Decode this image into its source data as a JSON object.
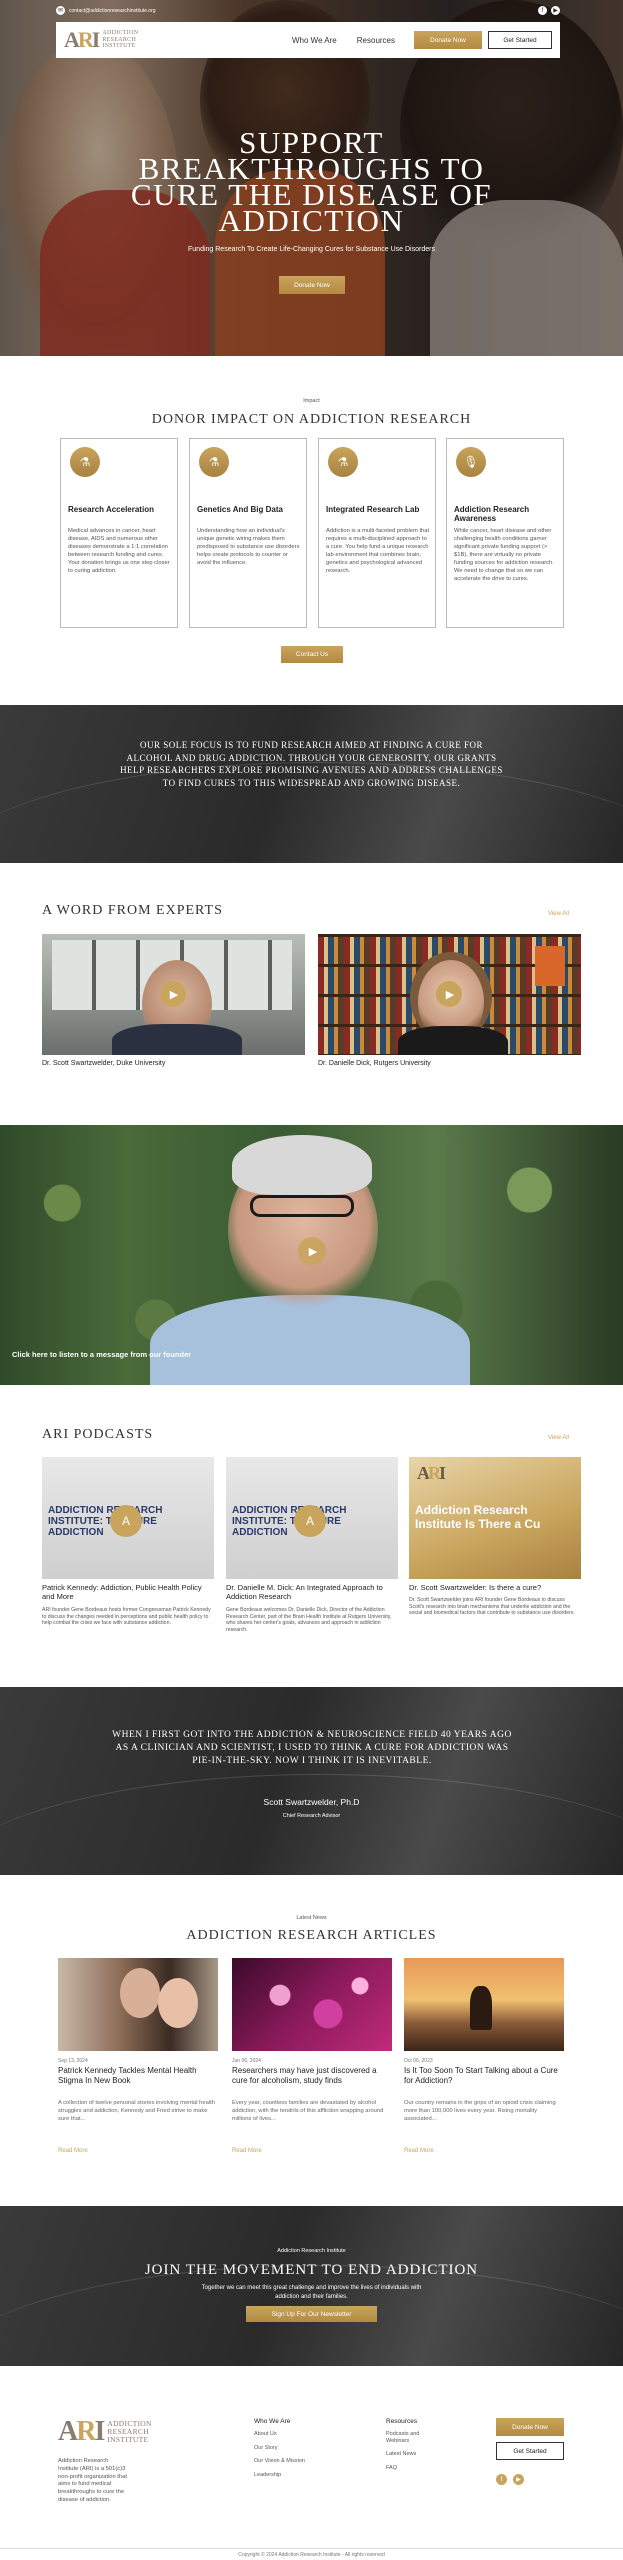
{
  "topbar": {
    "email": "contact@addictionresearchinstitute.org"
  },
  "brand": {
    "mark": "ARI",
    "name_line1": "Addiction",
    "name_line2": "Research",
    "name_line3": "Institute"
  },
  "nav": {
    "who_we_are": "Who We Are",
    "resources": "Resources",
    "donate": "Donate Now",
    "get_started": "Get Started"
  },
  "hero": {
    "title": "Support Breakthroughs to Cure the Disease of Addiction",
    "subtitle": "Funding Research To Create Life-Changing Cures for Substance Use Disorders",
    "cta": "Donate Now"
  },
  "impact": {
    "kicker": "Impact",
    "title": "Donor Impact on Addiction Research",
    "cards": [
      {
        "icon": "flask-icon",
        "title": "Research Acceleration",
        "desc": "Medical advances in cancer, heart disease, AIDS and numerous other diseases demonstrate a 1:1 correlation between research funding and cures. Your donation brings us one step closer to curing addiction."
      },
      {
        "icon": "dna-icon",
        "title": "Genetics And Big Data",
        "desc": "Understanding how an individual's unique genetic wiring makes them predisposed to substance use disorders helps create protocols to counter or avoid the influence."
      },
      {
        "icon": "lab-icon",
        "title": "Integrated Research Lab",
        "desc": "Addiction is a multi-faceted problem that requires a multi-disciplined approach to a cure. You help fund a unique research lab environment that combines brain, genetics and psychological advanced research."
      },
      {
        "icon": "microphone-icon",
        "title": "Addiction Research Awareness",
        "desc": "While cancer, heart disease and other challenging health conditions garner significant private funding support (> $1B), there are virtually no private funding sources for addiction research. We need to change that so we can accelerate the drive to cures."
      }
    ],
    "contact": "Contact Us"
  },
  "focus": {
    "text": "Our sole focus is to fund research aimed at finding a cure for alcohol and drug addiction. Through your generosity, our grants help researchers explore promising avenues and address challenges to find cures to this widespread and growing disease."
  },
  "experts": {
    "title": "A Word From Experts",
    "view_all": "View All",
    "videos": [
      {
        "caption": "Dr. Scott Swartzwelder, Duke University"
      },
      {
        "caption": "Dr. Danielle Dick, Rutgers University"
      }
    ]
  },
  "founder": {
    "caption": "Click here to listen to a message from our founder"
  },
  "podcasts": {
    "title": "ARI Podcasts",
    "view_all": "View All",
    "items": [
      {
        "thumb_text": "ADDICTION RESEARCH INSTITUTE: THE CURE ADDICTION",
        "title": "Patrick Kennedy: Addiction, Public Health Policy and More",
        "desc": "ARI founder Gene Bordeaux hosts former Congressman Patrick Kennedy to discuss the changes needed in perceptions and public health policy to help combat the crisis we face with substance addiction."
      },
      {
        "thumb_text": "ADDICTION RESEARCH INSTITUTE: THE CURE ADDICTION",
        "title": "Dr. Danielle M. Dick: An Integrated Approach to Addiction Research",
        "desc": "Gene Bordeaux welcomes Dr. Danielle Dick, Director of the Addiction Research Center, part of the Brain Health Institute at Rutgers University, who shares her center's goals, advances and approach in addiction research."
      },
      {
        "thumb_text": "Addiction Research Institute Is There a Cu",
        "title": "Dr. Scott Swartzwelder: Is there a cure?",
        "desc": "Dr. Scott Swartzwelder joins ARI founder Gene Bordeaux to discuss Scott's research into brain mechanisms that underlie addiction and the social and biomedical factors that contribute to substance use disorders."
      }
    ]
  },
  "quote": {
    "text": "When I first got into the addiction & neuroscience field 40 years ago as a clinician and scientist, I used to think a cure for addiction was pie-in-the-sky. Now I think it is inevitable.",
    "name": "Scott Swartzwelder, Ph.D",
    "role": "Chief Research Advisor"
  },
  "articles": {
    "kicker": "Latest News",
    "title": "Addiction Research Articles",
    "items": [
      {
        "date": "Sep 13, 2024",
        "title": "Patrick Kennedy Tackles Mental Health Stigma In New Book",
        "desc": "A collection of twelve personal stories involving mental health struggles and addiction, Kennedy and Fried strive to make sure that...",
        "more": "Read More"
      },
      {
        "date": "Jun 06, 2024",
        "title": "Researchers may have just discovered a cure for alcoholism, study finds",
        "desc": "Every year, countless families are devastated by alcohol addiction, with the tendrils of this affliction wrapping around millions of lives...",
        "more": "Read More"
      },
      {
        "date": "Oct 06, 2023",
        "title": "Is It Too Soon To Start Talking about a Cure for Addiction?",
        "desc": "Our country remains in the grips of an opioid crisis claiming more than 100,000 lives every year. Rising mortality associated...",
        "more": "Read More"
      }
    ]
  },
  "join": {
    "kicker": "Addiction Research Institute",
    "title": "Join the Movement to End Addiction",
    "desc": "Together we can meet this great challenge and improve the lives of individuals with addiction and their families.",
    "cta": "Sign Up For Our Newsletter"
  },
  "footer": {
    "desc": "Addiction Research Institute (ARI) is a 501(c)3 non-profit organization that aims to fund medical breakthroughs to cure the disease of addiction.",
    "col1": {
      "heading": "Who We Are",
      "items": [
        "About Us",
        "Our Story",
        "Our Vision & Mission",
        "Leadership"
      ]
    },
    "col2": {
      "heading": "Resources",
      "items": [
        "Podcasts and Webinars",
        "Latest News",
        "FAQ"
      ]
    },
    "donate": "Donate Now",
    "get_started": "Get Started",
    "copyright": "Copyright © 2024 Addiction Research Institute - All rights reserved"
  }
}
